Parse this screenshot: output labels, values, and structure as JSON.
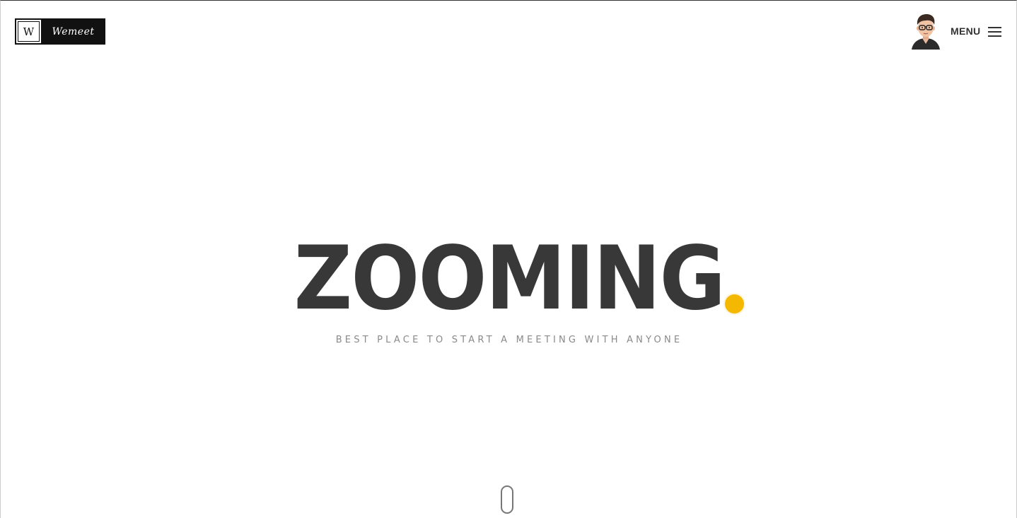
{
  "header": {
    "logo": {
      "mark": "W",
      "text": "Wemeet"
    },
    "avatar_icon": "user-avatar-icon",
    "menu_label": "MENU",
    "menu_icon": "hamburger-menu-icon"
  },
  "hero": {
    "title": "ZOOMING",
    "subtitle": "BEST PLACE TO START A MEETING WITH ANYONE",
    "accent_color": "#f5b800"
  },
  "scroll_indicator_icon": "mouse-scroll-icon",
  "colors": {
    "text_dark": "#383838",
    "text_muted": "#8a8a8a",
    "background": "#ffffff"
  }
}
